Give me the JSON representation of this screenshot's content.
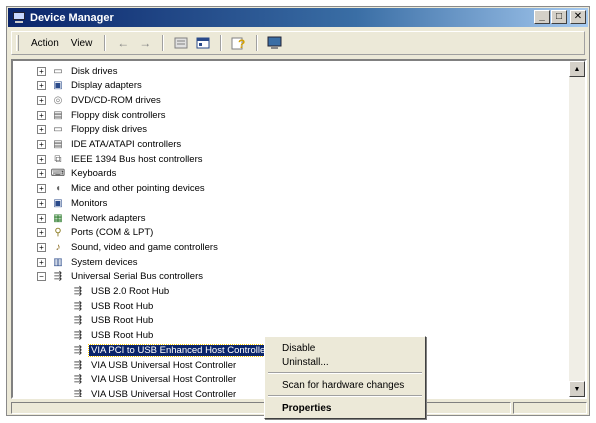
{
  "window": {
    "title": "Device Manager"
  },
  "menubar": {
    "action_label": "Action",
    "view_label": "View"
  },
  "toolbar": {
    "buttons": [
      "back-icon",
      "forward-icon",
      "properties-sheet-icon",
      "show-hide-tree-icon",
      "help-icon",
      "scan-hardware-icon"
    ]
  },
  "tree": {
    "categories": [
      {
        "label": "Disk drives",
        "icon": "disk-drive-icon"
      },
      {
        "label": "Display adapters",
        "icon": "display-adapter-icon"
      },
      {
        "label": "DVD/CD-ROM drives",
        "icon": "cdrom-icon"
      },
      {
        "label": "Floppy disk controllers",
        "icon": "floppy-controller-icon"
      },
      {
        "label": "Floppy disk drives",
        "icon": "floppy-drive-icon"
      },
      {
        "label": "IDE ATA/ATAPI controllers",
        "icon": "ide-controller-icon"
      },
      {
        "label": "IEEE 1394 Bus host controllers",
        "icon": "firewire-icon"
      },
      {
        "label": "Keyboards",
        "icon": "keyboard-icon"
      },
      {
        "label": "Mice and other pointing devices",
        "icon": "mouse-icon"
      },
      {
        "label": "Monitors",
        "icon": "monitor-icon"
      },
      {
        "label": "Network adapters",
        "icon": "network-adapter-icon"
      },
      {
        "label": "Ports (COM & LPT)",
        "icon": "port-icon"
      },
      {
        "label": "Sound, video and game controllers",
        "icon": "sound-icon"
      },
      {
        "label": "System devices",
        "icon": "system-device-icon"
      },
      {
        "label": "Universal Serial Bus controllers",
        "icon": "usb-icon"
      }
    ],
    "usb_children": [
      "USB 2.0 Root Hub",
      "USB Root Hub",
      "USB Root Hub",
      "USB Root Hub",
      "VIA PCI to USB Enhanced Host Controller",
      "VIA USB Universal Host Controller",
      "VIA USB Universal Host Controller",
      "VIA USB Universal Host Controller"
    ],
    "selected_child_index": 4
  },
  "context_menu": {
    "disable": "Disable",
    "uninstall": "Uninstall...",
    "scan": "Scan for hardware changes",
    "properties": "Properties"
  },
  "colors": {
    "selection": "#0a246a",
    "titlebar": "#0a246a",
    "face": "#ece9d8"
  }
}
